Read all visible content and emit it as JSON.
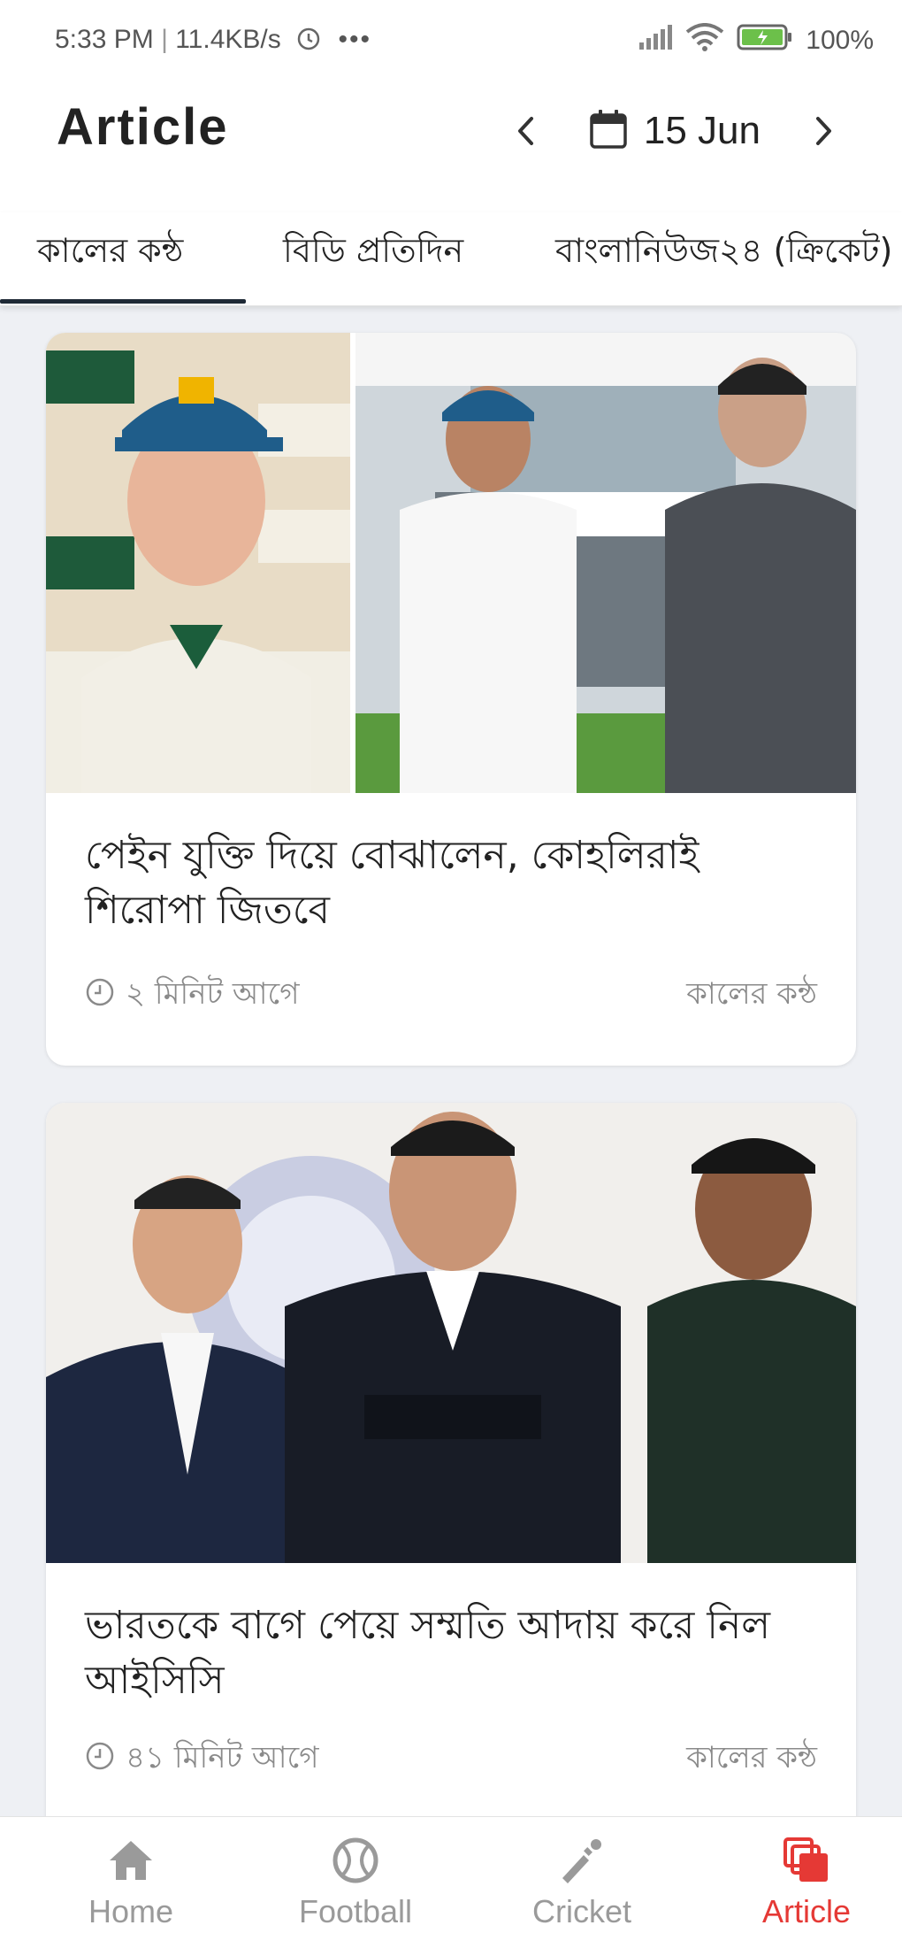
{
  "status_bar": {
    "time": "5:33 PM",
    "net_speed": "11.4KB/s",
    "battery": "100%",
    "icons": [
      "alarm-icon",
      "more-dots-icon",
      "signal-icon",
      "wifi-icon",
      "battery-icon"
    ]
  },
  "header": {
    "title": "Article",
    "date": "15 Jun",
    "icons": [
      "chevron-left-icon",
      "calendar-icon",
      "chevron-right-icon"
    ]
  },
  "tabs": [
    {
      "label": "কালের কন্ঠ",
      "active": true
    },
    {
      "label": "বিডি প্রতিদিন",
      "active": false
    },
    {
      "label": "বাংলানিউজ২৪ (ক্রিকেট)",
      "active": false
    }
  ],
  "articles": [
    {
      "title": "পেইন যুক্তি দিয়ে বোঝালেন, কোহলিরাই শিরোপা জিতবে",
      "time": "২ মিনিট আগে",
      "source": "কালের কন্ঠ"
    },
    {
      "title": "ভারতকে বাগে পেয়ে সম্মতি আদায় করে নিল আইসিসি",
      "time": "৪১ মিনিট আগে",
      "source": "কালের কন্ঠ"
    }
  ],
  "bottom_nav": [
    {
      "label": "Home",
      "icon": "home-icon",
      "active": false
    },
    {
      "label": "Football",
      "icon": "football-icon",
      "active": false
    },
    {
      "label": "Cricket",
      "icon": "cricket-icon",
      "active": false
    },
    {
      "label": "Article",
      "icon": "article-icon",
      "active": true
    }
  ],
  "colors": {
    "accent": "#e53935",
    "tab_indicator": "#1f2a36",
    "background": "#eef0f4"
  }
}
